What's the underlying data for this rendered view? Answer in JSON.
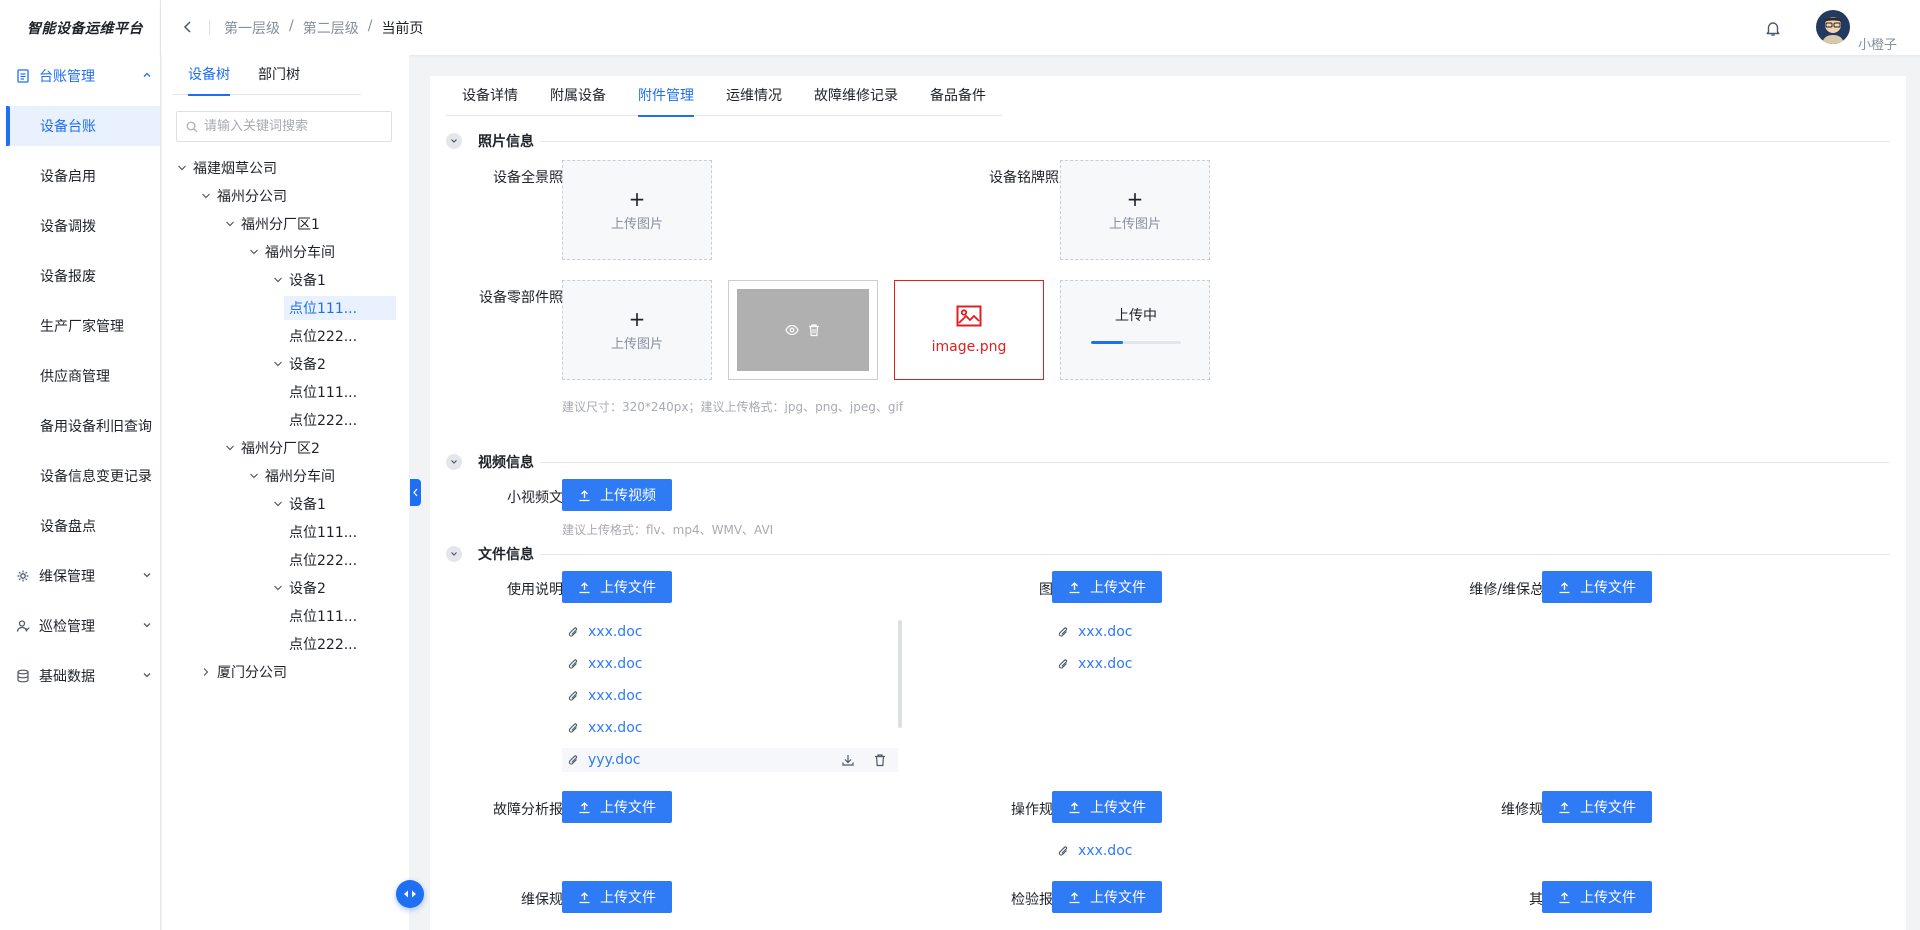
{
  "app": {
    "title": "智能设备运维平台"
  },
  "header": {
    "breadcrumb": [
      "第一层级",
      "第二层级",
      "当前页"
    ],
    "breadcrumb_sep": "/",
    "user_name": "小橙子"
  },
  "sidebar": {
    "groups": [
      {
        "label": "台账管理",
        "icon": "ledger-icon",
        "expanded": true
      },
      {
        "label": "维保管理",
        "icon": "maintenance-icon",
        "expanded": false
      },
      {
        "label": "巡检管理",
        "icon": "inspection-icon",
        "expanded": false
      },
      {
        "label": "基础数据",
        "icon": "database-icon",
        "expanded": false
      }
    ],
    "ledger_items": [
      "设备台账",
      "设备启用",
      "设备调拨",
      "设备报废",
      "生产厂家管理",
      "供应商管理",
      "备用设备利旧查询",
      "设备信息变更记录",
      "设备盘点"
    ],
    "selected_item": "设备台账"
  },
  "tree": {
    "tabs": [
      "设备树",
      "部门树"
    ],
    "active_tab": "设备树",
    "search_placeholder": "请输入关键词搜索",
    "nodes": [
      {
        "label": "福建烟草公司",
        "level": 0,
        "expanded": true
      },
      {
        "label": "福州分公司",
        "level": 1,
        "expanded": true
      },
      {
        "label": "福州分厂区1",
        "level": 2,
        "expanded": true
      },
      {
        "label": "福州分车间",
        "level": 3,
        "expanded": true
      },
      {
        "label": "设备1",
        "level": 4,
        "expanded": true
      },
      {
        "label": "点位111...",
        "level": 5,
        "leaf": true,
        "selected": true
      },
      {
        "label": "点位222...",
        "level": 5,
        "leaf": true
      },
      {
        "label": "设备2",
        "level": 4,
        "expanded": true
      },
      {
        "label": "点位111...",
        "level": 5,
        "leaf": true
      },
      {
        "label": "点位222...",
        "level": 5,
        "leaf": true
      },
      {
        "label": "福州分厂区2",
        "level": 2,
        "expanded": true
      },
      {
        "label": "福州分车间",
        "level": 3,
        "expanded": true
      },
      {
        "label": "设备1",
        "level": 4,
        "expanded": true
      },
      {
        "label": "点位111...",
        "level": 5,
        "leaf": true
      },
      {
        "label": "点位222...",
        "level": 5,
        "leaf": true
      },
      {
        "label": "设备2",
        "level": 4,
        "expanded": true
      },
      {
        "label": "点位111...",
        "level": 5,
        "leaf": true
      },
      {
        "label": "点位222...",
        "level": 5,
        "leaf": true
      },
      {
        "label": "厦门分公司",
        "level": 1,
        "expanded": false
      }
    ]
  },
  "main": {
    "tabs": [
      "设备详情",
      "附属设备",
      "附件管理",
      "运维情况",
      "故障维修记录",
      "备品备件"
    ],
    "active_tab": "附件管理",
    "photo_section": {
      "title": "照片信息",
      "panorama_label": "设备全景照片",
      "nameplate_label": "设备铭牌照片",
      "parts_label": "设备零部件照片",
      "upload_text": "上传图片",
      "plus": "+",
      "error_file": "image.png",
      "uploading_text": "上传中",
      "upload_progress": 0.35,
      "hint": "建议尺寸：320*240px；建议上传格式：jpg、png、jpeg、gif"
    },
    "video_section": {
      "title": "视频信息",
      "label": "小视频文件",
      "button": "上传视频",
      "hint": "建议上传格式：flv、mp4、WMV、AVI"
    },
    "file_section": {
      "title": "文件信息",
      "button": "上传文件",
      "fields": [
        {
          "label": "使用说明书",
          "files": [
            "xxx.doc",
            "xxx.doc",
            "xxx.doc",
            "xxx.doc",
            "yyy.doc"
          ]
        },
        {
          "label": "图纸",
          "files": [
            "xxx.doc",
            "xxx.doc"
          ]
        },
        {
          "label": "维修/维保总结",
          "files": []
        },
        {
          "label": "故障分析报告",
          "files": []
        },
        {
          "label": "操作规程",
          "files": [
            "xxx.doc"
          ]
        },
        {
          "label": "维修规程",
          "files": []
        },
        {
          "label": "维保规程",
          "files": []
        },
        {
          "label": "检验报告",
          "files": []
        },
        {
          "label": "其他",
          "files": []
        }
      ]
    }
  },
  "colors": {
    "primary": "#1f6ff2",
    "button": "#2f7bf5",
    "error": "#e02020",
    "text": "#1f2329",
    "muted": "#86909c"
  }
}
